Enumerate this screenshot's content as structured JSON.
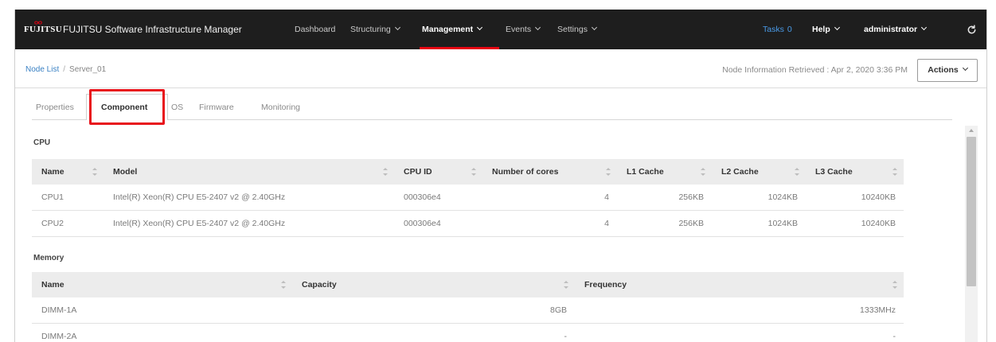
{
  "header": {
    "logo_text": "FUJITSU",
    "app_title": "FUJITSU Software Infrastructure Manager",
    "nav": [
      {
        "label": "Dashboard",
        "has_dropdown": false,
        "active": false
      },
      {
        "label": "Structuring",
        "has_dropdown": true,
        "active": false
      },
      {
        "label": "Management",
        "has_dropdown": true,
        "active": true
      },
      {
        "label": "Events",
        "has_dropdown": true,
        "active": false
      },
      {
        "label": "Settings",
        "has_dropdown": true,
        "active": false
      }
    ],
    "tasks": {
      "label": "Tasks",
      "count": "0"
    },
    "help_label": "Help",
    "user_label": "administrator"
  },
  "breadcrumb": {
    "parent": "Node List",
    "separator": "/",
    "current": "Server_01"
  },
  "retrieved_info": "Node Information Retrieved : Apr 2, 2020 3:36 PM",
  "actions_label": "Actions",
  "tabs": [
    {
      "label": "Properties",
      "active": false
    },
    {
      "label": "Component",
      "active": true,
      "highlighted": true
    },
    {
      "label": "OS",
      "active": false
    },
    {
      "label": "Firmware",
      "active": false
    },
    {
      "label": "Monitoring",
      "active": false
    }
  ],
  "cpu": {
    "title": "CPU",
    "columns": [
      "Name",
      "Model",
      "CPU ID",
      "Number of cores",
      "L1 Cache",
      "L2 Cache",
      "L3 Cache"
    ],
    "rows": [
      [
        "CPU1",
        "Intel(R) Xeon(R) CPU E5-2407 v2 @ 2.40GHz",
        "000306e4",
        "4",
        "256KB",
        "1024KB",
        "10240KB"
      ],
      [
        "CPU2",
        "Intel(R) Xeon(R) CPU E5-2407 v2 @ 2.40GHz",
        "000306e4",
        "4",
        "256KB",
        "1024KB",
        "10240KB"
      ]
    ]
  },
  "memory": {
    "title": "Memory",
    "columns": [
      "Name",
      "Capacity",
      "Frequency"
    ],
    "rows": [
      [
        "DIMM-1A",
        "8GB",
        "1333MHz"
      ],
      [
        "DIMM-2A",
        "-",
        "-"
      ]
    ]
  },
  "icons": {
    "logo_mark": "fujitsu-infinity-mark",
    "dropdown": "chevron-down-icon",
    "sort": "sort-icon",
    "refresh": "refresh-icon",
    "scroll_up": "scroll-up-arrow-icon"
  },
  "colors": {
    "header_bg": "#1e1e1e",
    "nav_active_underline": "#e60012",
    "tasks_link": "#4a9be8",
    "breadcrumb_link": "#3b82c4",
    "highlight_box": "#e8141c",
    "table_header_bg": "#ececec"
  }
}
